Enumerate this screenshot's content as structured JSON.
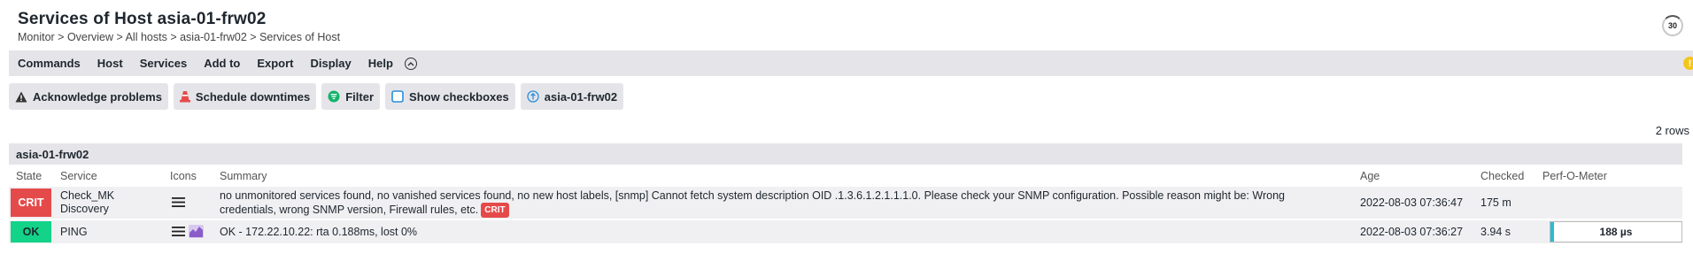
{
  "page": {
    "title": "Services of Host asia-01-frw02",
    "breadcrumb": [
      "Monitor",
      "Overview",
      "All hosts",
      "asia-01-frw02",
      "Services of Host"
    ],
    "breadcrumb_sep": " > ",
    "reload_seconds": "30"
  },
  "menu": {
    "items": [
      "Commands",
      "Host",
      "Services",
      "Add to",
      "Export",
      "Display",
      "Help"
    ]
  },
  "actions": {
    "acknowledge": "Acknowledge problems",
    "downtimes": "Schedule downtimes",
    "filter": "Filter",
    "checkboxes": "Show checkboxes",
    "host": "asia-01-frw02"
  },
  "table": {
    "rows_count": "2 rows",
    "group": "asia-01-frw02",
    "columns": [
      "State",
      "Service",
      "Icons",
      "Summary",
      "Age",
      "Checked",
      "Perf-O-Meter"
    ],
    "rows": [
      {
        "state": "CRIT",
        "service_line1": "Check_MK",
        "service_line2": "Discovery",
        "summary_line1": "no unmonitored services found, no vanished services found, no new host labels, [snmp] Cannot fetch system description OID .1.3.6.1.2.1.1.1.0. Please check your SNMP configuration. Possible reason might be: Wrong",
        "summary_line2": "credentials, wrong SNMP version, Firewall rules, etc.",
        "summary_badge": "CRIT",
        "age": "2022-08-03 07:36:47",
        "checked": "175 m"
      },
      {
        "state": "OK",
        "service_line1": "PING",
        "summary_line1": "OK - 172.22.10.22: rta 0.188ms, lost 0%",
        "age": "2022-08-03 07:36:27",
        "checked": "3.94 s",
        "perf_text": "188 µs",
        "perf_level": 0.03
      }
    ]
  },
  "colors": {
    "crit": "#e54a4a",
    "ok": "#13d389",
    "bar": "#e5e5e9",
    "perf": "#2bbcd4",
    "warn": "#f5c519"
  }
}
